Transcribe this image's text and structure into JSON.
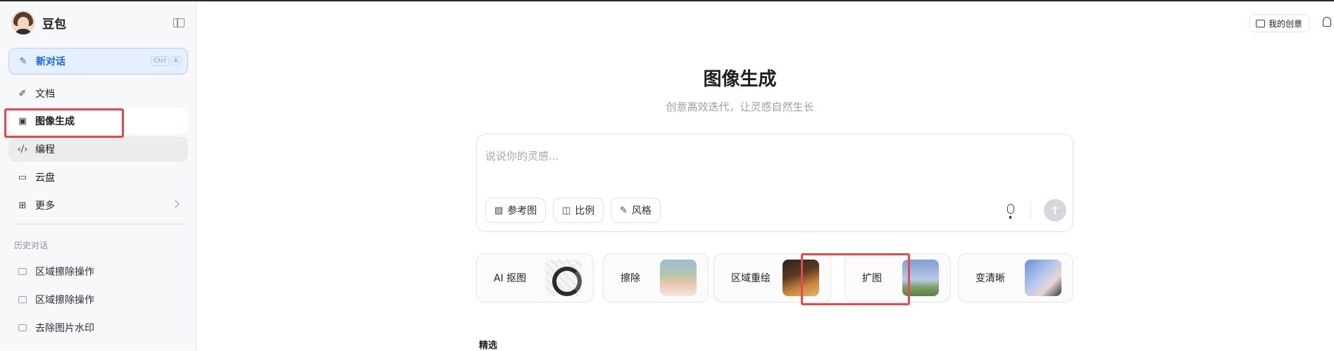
{
  "app": {
    "name": "豆包"
  },
  "sidebar": {
    "new_chat": {
      "label": "新对话",
      "shortcut": [
        "Ctrl",
        "K"
      ]
    },
    "items": [
      {
        "label": "文档",
        "icon": "pen-icon"
      },
      {
        "label": "图像生成",
        "icon": "image-gen-icon",
        "selected": true
      },
      {
        "label": "编程",
        "icon": "code-icon"
      },
      {
        "label": "云盘",
        "icon": "cloud-drive-icon"
      },
      {
        "label": "更多",
        "icon": "grid-plus-icon"
      }
    ],
    "history_title": "历史对话",
    "history": [
      {
        "label": "区域擦除操作"
      },
      {
        "label": "区域擦除操作"
      },
      {
        "label": "去除图片水印"
      }
    ]
  },
  "header": {
    "my_creative": "我的创意"
  },
  "main": {
    "title": "图像生成",
    "subtitle": "创意高效迭代，让灵感自然生长",
    "prompt": {
      "placeholder": "说说你的灵感...",
      "value": ""
    },
    "chips": {
      "reference": "参考图",
      "ratio": "比例",
      "style": "风格"
    },
    "tools": [
      {
        "label": "AI 抠图"
      },
      {
        "label": "擦除"
      },
      {
        "label": "区域重绘"
      },
      {
        "label": "扩图"
      },
      {
        "label": "变清晰"
      }
    ],
    "featured_title": "精选"
  },
  "colors": {
    "accent": "#1864f2",
    "highlight_box": "#e5484d",
    "sidebar_bg": "#f7f8fa"
  }
}
